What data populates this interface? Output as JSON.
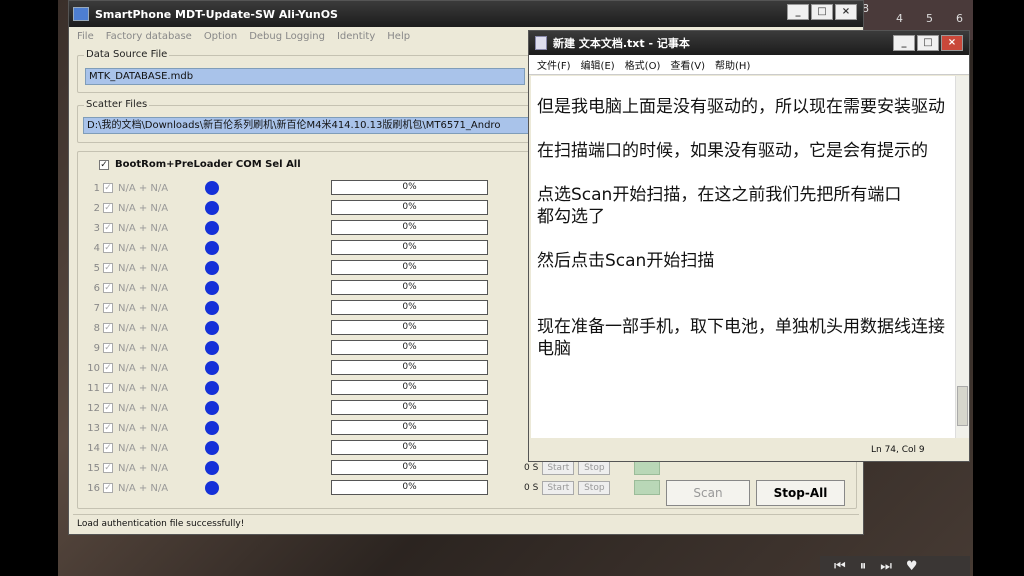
{
  "desktop": {
    "calendar": [
      "8",
      "4",
      "5",
      "6"
    ],
    "media_controls": [
      "⏮",
      "⏸",
      "⏭",
      "♥"
    ]
  },
  "app": {
    "title": "SmartPhone MDT-Update-SW Ali-YunOS",
    "window_buttons": [
      "_",
      "□",
      "×"
    ],
    "menu": [
      "File",
      "Factory database",
      "Option",
      "Debug Logging",
      "Identity",
      "Help"
    ],
    "data_source_label": "Data Source File",
    "data_source_value": "MTK_DATABASE.mdb",
    "scatter_label": "Scatter Files",
    "scatter_value": "D:\\我的文档\\Downloads\\新百伦系列刷机\\新百伦M4米414.10.13版刷机包\\MT6571_Andro",
    "select_all_label": "BootRom+PreLoader COM Sel All",
    "rows": [
      {
        "num": "1",
        "label": "N/A + N/A",
        "progress": "0%"
      },
      {
        "num": "2",
        "label": "N/A + N/A",
        "progress": "0%"
      },
      {
        "num": "3",
        "label": "N/A + N/A",
        "progress": "0%"
      },
      {
        "num": "4",
        "label": "N/A + N/A",
        "progress": "0%"
      },
      {
        "num": "5",
        "label": "N/A + N/A",
        "progress": "0%"
      },
      {
        "num": "6",
        "label": "N/A + N/A",
        "progress": "0%"
      },
      {
        "num": "7",
        "label": "N/A + N/A",
        "progress": "0%"
      },
      {
        "num": "8",
        "label": "N/A + N/A",
        "progress": "0%"
      },
      {
        "num": "9",
        "label": "N/A + N/A",
        "progress": "0%"
      },
      {
        "num": "10",
        "label": "N/A + N/A",
        "progress": "0%"
      },
      {
        "num": "11",
        "label": "N/A + N/A",
        "progress": "0%"
      },
      {
        "num": "12",
        "label": "N/A + N/A",
        "progress": "0%"
      },
      {
        "num": "13",
        "label": "N/A + N/A",
        "progress": "0%"
      },
      {
        "num": "14",
        "label": "N/A + N/A",
        "progress": "0%"
      },
      {
        "num": "15",
        "label": "N/A + N/A",
        "progress": "0%"
      },
      {
        "num": "16",
        "label": "N/A + N/A",
        "progress": "0%"
      }
    ],
    "row_tail": {
      "time": "0 S",
      "start": "Start",
      "stop": "Stop"
    },
    "scan_label": "Scan",
    "stop_all_label": "Stop-All",
    "status_text": "Load authentication file successfully!",
    "colors": {
      "dot": "#1530d8",
      "selection": "#a9c3ea",
      "indicator": "#b9d7b7"
    }
  },
  "notepad": {
    "title": "新建 文本文档.txt - 记事本",
    "window_buttons": [
      "_",
      "□",
      "×"
    ],
    "menu": [
      "文件(F)",
      "编辑(E)",
      "格式(O)",
      "查看(V)",
      "帮助(H)"
    ],
    "paragraphs": [
      "但是我电脑上面是没有驱动的，所以现在需要安装驱动",
      "在扫描端口的时候，如果没有驱动，它是会有提示的",
      "点选Scan开始扫描，在这之前我们先把所有端口\n都勾选了",
      "然后点击Scan开始扫描",
      "现在准备一部手机，取下电池，单独机头用数据线连接电脑"
    ],
    "cursor_status": "Ln 74, Col 9"
  }
}
